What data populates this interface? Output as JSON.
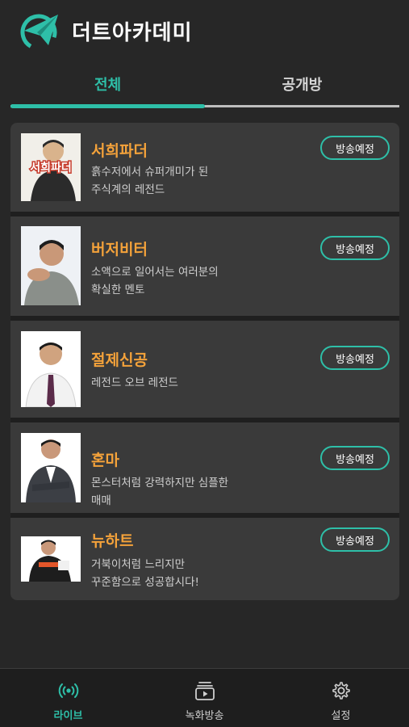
{
  "app": {
    "title": "더트아카데미"
  },
  "tabs": [
    {
      "label": "전체",
      "active": true
    },
    {
      "label": "공개방",
      "active": false
    }
  ],
  "streamers": [
    {
      "name": "서희파더",
      "desc_line1": "흙수저에서 슈퍼개미가 된",
      "desc_line2": "주식계의 레전드",
      "badge": "방송예정",
      "thumb_text": "서희파더"
    },
    {
      "name": "버저비터",
      "desc_line1": "소액으로 일어서는 여러분의",
      "desc_line2": "확실한 멘토",
      "badge": "방송예정"
    },
    {
      "name": "절제신공",
      "desc_line1": "레전드 오브 레전드",
      "desc_line2": "",
      "badge": "방송예정"
    },
    {
      "name": "혼마",
      "desc_line1": "몬스터처럼 강력하지만 심플한",
      "desc_line2": "매매",
      "badge": "방송예정"
    },
    {
      "name": "뉴하트",
      "desc_line1": "거북이처럼 느리지만",
      "desc_line2": "꾸준함으로 성공합시다!",
      "badge": "방송예정"
    }
  ],
  "bottom_nav": [
    {
      "label": "라이브",
      "icon": "broadcast-icon",
      "active": true
    },
    {
      "label": "녹화방송",
      "icon": "video-library-icon",
      "active": false
    },
    {
      "label": "설정",
      "icon": "gear-icon",
      "active": false
    }
  ],
  "colors": {
    "accent": "#2ebfa8",
    "name": "#f4a23a",
    "background": "#272727",
    "card": "#3a3a3a"
  }
}
